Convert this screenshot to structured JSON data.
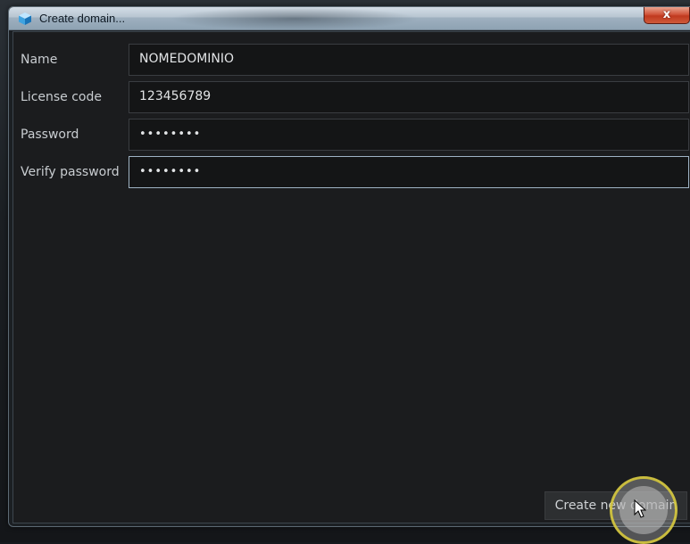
{
  "window": {
    "title": "Create domain...",
    "close_label": "x"
  },
  "form": {
    "fields": [
      {
        "label": "Name",
        "value": "NOMEDOMINIO",
        "type": "text"
      },
      {
        "label": "License code",
        "value": "123456789",
        "type": "text"
      },
      {
        "label": "Password",
        "value": "••••••••",
        "type": "password"
      },
      {
        "label": "Verify password",
        "value": "••••••••",
        "type": "password"
      }
    ]
  },
  "actions": {
    "create_label": "Create new domain"
  },
  "icons": {
    "app": "cube-icon",
    "close": "close-icon",
    "cursor": "mouse-pointer-icon"
  },
  "colors": {
    "background": "#1b1c1e",
    "input_bg": "#141516",
    "focus_border": "#9fb3c4",
    "close_button": "#c0391f",
    "click_highlight": "#d6c83c"
  }
}
